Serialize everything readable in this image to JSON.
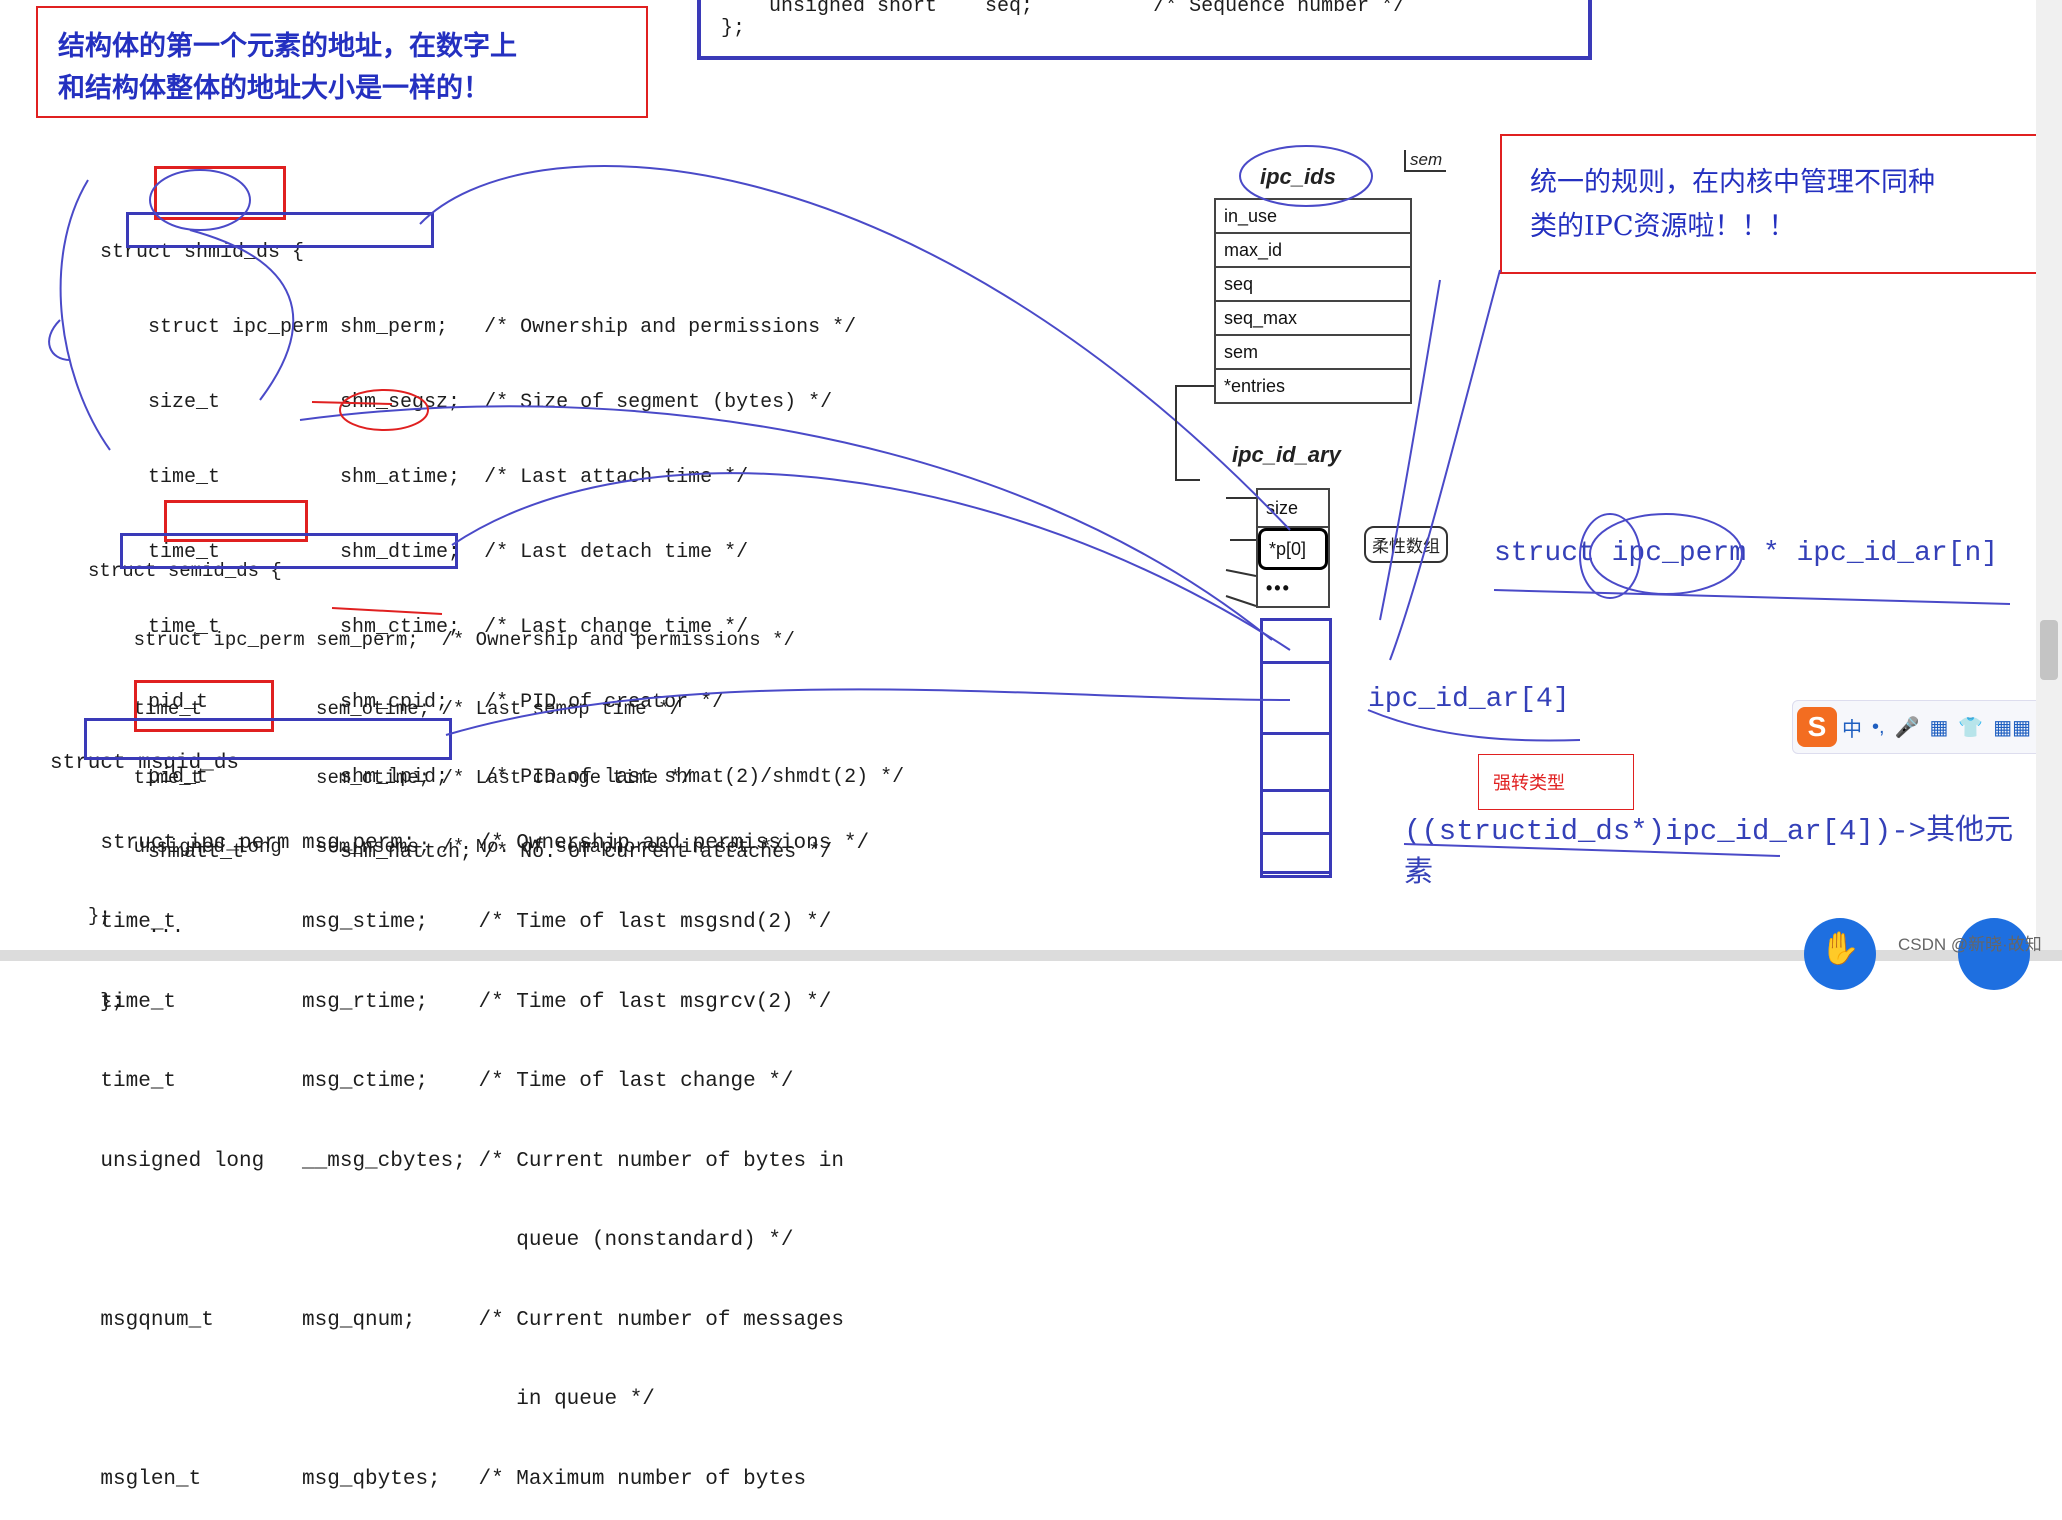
{
  "top_note": {
    "line1": "结构体的第一个元素的地址，在数字上",
    "line2": "和结构体整体的地址大小是一样的！"
  },
  "top_code": {
    "line1": "    unsigned short    seq;          /* Sequence number */",
    "line2": "};"
  },
  "right_note": {
    "line1": "统一的规则，在内核中管理不同种",
    "line2": "类的IPC资源啦！！！"
  },
  "shmid_ds": {
    "lines": [
      "struct shmid_ds {",
      "    struct ipc_perm shm_perm;   /* Ownership and permissions */",
      "    size_t          shm_segsz;  /* Size of segment (bytes) */",
      "    time_t          shm_atime;  /* Last attach time */",
      "    time_t          shm_dtime;  /* Last detach time */",
      "    time_t          shm_ctime;  /* Last change time */",
      "    pid_t           shm_cpid;   /* PID of creator */",
      "    pid_t           shm_lpid;   /* PID of last shmat(2)/shmdt(2) */",
      "    shmatt_t        shm_nattch; /* No. of current attaches */",
      "    ...",
      "};"
    ]
  },
  "semid_ds": {
    "lines": [
      "struct semid_ds {",
      "    struct ipc_perm sem_perm;  /* Ownership and permissions */",
      "    time_t          sem_otime; /* Last semop time */",
      "    time_t          sem_ctime; /* Last change time */",
      "    unsigned long   sem_nsems; /* No. of semaphores in set */",
      "};"
    ]
  },
  "msqid_ds": {
    "lines": [
      "struct msqid_ds",
      "    struct ipc_perm msg_perm;     /* Ownership and permissions */",
      "    time_t          msg_stime;    /* Time of last msgsnd(2) */",
      "    time_t          msg_rtime;    /* Time of last msgrcv(2) */",
      "    time_t          msg_ctime;    /* Time of last change */",
      "    unsigned long   __msg_cbytes; /* Current number of bytes in",
      "                                     queue (nonstandard) */",
      "    msgqnum_t       msg_qnum;     /* Current number of messages",
      "                                     in queue */",
      "    msglen_t        msg_qbytes;   /* Maximum number of bytes"
    ]
  },
  "ipc_ids": {
    "title": "ipc_ids",
    "tag": "sem",
    "fields": [
      "in_use",
      "max_id",
      "seq",
      "seq_max",
      "sem",
      "*entries"
    ]
  },
  "ipc_id_ary": {
    "title": "ipc_id_ary",
    "fields": [
      "size",
      "*p[0]",
      "•••"
    ],
    "flex_label": "柔性数组"
  },
  "hand_notes": {
    "decl": "struct ipc_perm * ipc_id_ar[n]",
    "elem": "ipc_id_ar[4]",
    "cast_label": "强转类型",
    "cast_expr_1": "((structid_ds*)ipc_id_ar[4])->其他元",
    "cast_expr_2": "素"
  },
  "ime_toolbar": {
    "logo": "S",
    "items": [
      "中",
      "•,",
      "🎤",
      "▦",
      "👕",
      "▦▦"
    ]
  },
  "watermark": "CSDN @新晓·故知",
  "colors": {
    "red": "#e02020",
    "blue": "#3a3ab8",
    "note_blue": "#2430c0"
  }
}
